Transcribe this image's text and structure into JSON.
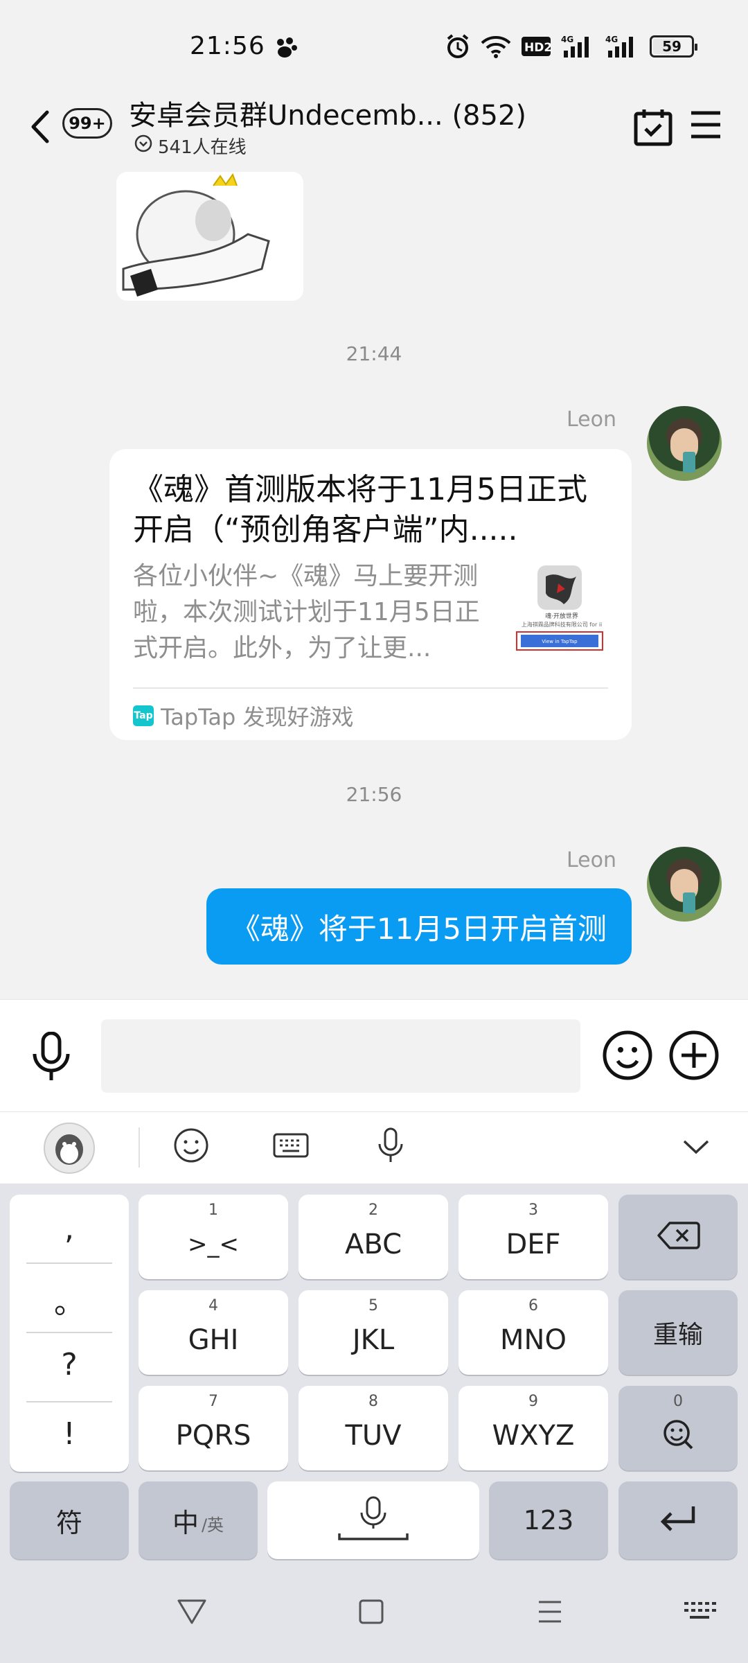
{
  "status_bar": {
    "time": "21:56",
    "battery": "59",
    "net1": "4G",
    "net2": "4G",
    "hd": "HD2",
    "icons": [
      "paw-icon",
      "alarm-icon",
      "wifi-icon",
      "hd-icon",
      "signal-icon",
      "signal-icon",
      "battery-icon"
    ]
  },
  "header": {
    "back_badge": "99+",
    "title": "安卓会员群Undecemb... (852)",
    "online": "541人在线",
    "icons": [
      "back-icon",
      "calendar-check-icon",
      "menu-icon"
    ]
  },
  "chat": {
    "timestamp1": "21:44",
    "sender1": "Leon",
    "card": {
      "title": "《魂》首测版本将于11月5日正式开启（“预创角客户端”内.....",
      "description": "各位小伙伴~《魂》马上要开测啦，本次测试计划于11月5日正式开启。此外，为了让更...",
      "thumb_caption1": "魂·开放世界",
      "thumb_caption2": "上海祺霖品牌科技有限公司 for ii",
      "thumb_button": "View in TapTap",
      "source_logo": "Tap",
      "source": "TapTap 发现好游戏"
    },
    "timestamp2": "21:56",
    "sender2": "Leon",
    "bubble_text": "《魂》将于11月5日开启首测"
  },
  "input_bar": {
    "placeholder": "",
    "icons": [
      "microphone-icon",
      "smiley-icon",
      "plus-icon"
    ]
  },
  "ime_bar": {
    "icons": [
      "qq-penguin-icon",
      "emoji-icon",
      "keyboard-icon",
      "voice-icon",
      "collapse-chevron-icon"
    ]
  },
  "keyboard": {
    "symbols": [
      ",",
      "。",
      "?",
      "!"
    ],
    "keys": [
      {
        "num": "1",
        "label": ">_<"
      },
      {
        "num": "2",
        "label": "ABC"
      },
      {
        "num": "3",
        "label": "DEF"
      },
      {
        "num": "4",
        "label": "GHI"
      },
      {
        "num": "5",
        "label": "JKL"
      },
      {
        "num": "6",
        "label": "MNO"
      },
      {
        "num": "7",
        "label": "PQRS"
      },
      {
        "num": "8",
        "label": "TUV"
      },
      {
        "num": "9",
        "label": "WXYZ"
      }
    ],
    "reenter": "重输",
    "zero_num": "0",
    "symbol_key": "符",
    "lang_main": "中",
    "lang_alt": "/英",
    "num_key": "123"
  },
  "nav_bar": {
    "icons": [
      "back-triangle-icon",
      "home-square-icon",
      "recents-icon",
      "keyboard-hide-icon"
    ]
  }
}
